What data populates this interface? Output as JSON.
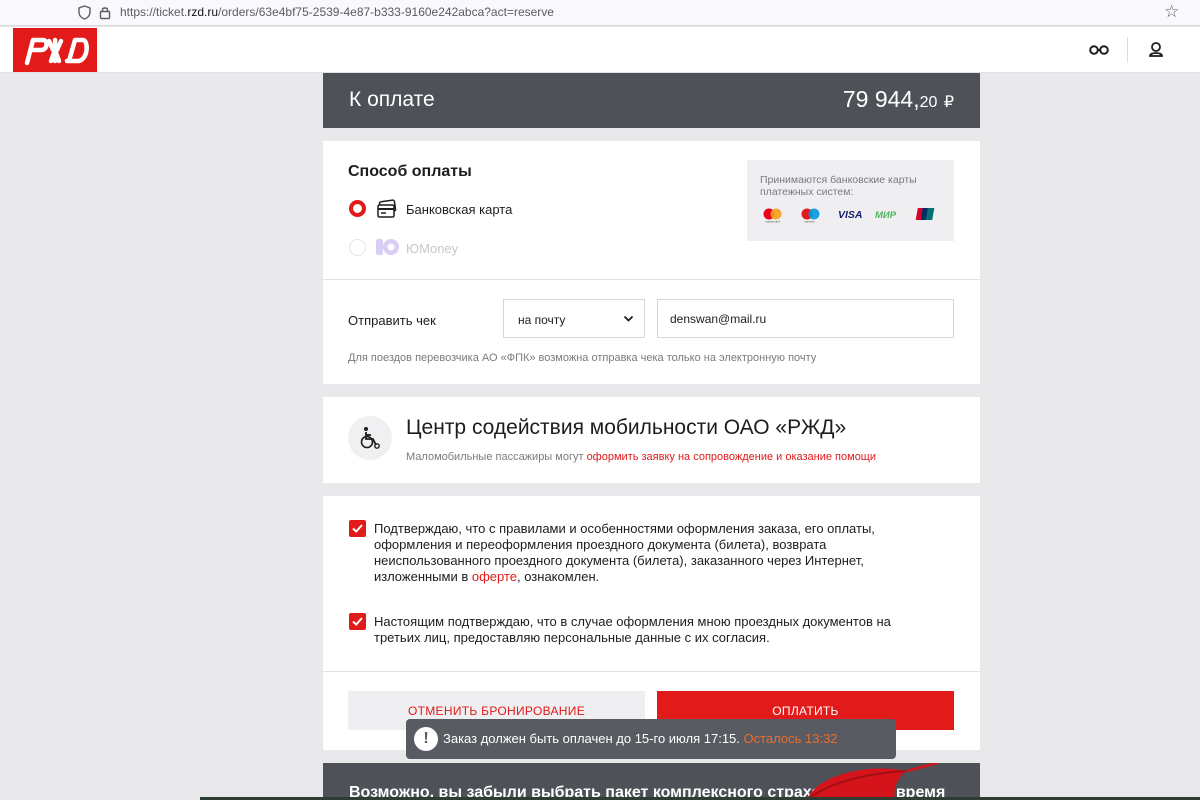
{
  "browser": {
    "url_prefix": "https://ticket.",
    "url_domain": "rzd.ru",
    "url_path": "/orders/63e4bf75-2539-4e87-b333-9160e242abca?act=reserve"
  },
  "header": {
    "logo_icon": "rzd-logo",
    "glasses_icon": "accessibility-glasses-icon",
    "user_icon": "user-icon"
  },
  "payment_header": {
    "title": "К оплате",
    "amount_main": "79 944,",
    "amount_kop": "20",
    "currency": "₽"
  },
  "payment_method": {
    "title": "Способ оплаты",
    "options": [
      {
        "label": "Банковская карта",
        "selected": true,
        "enabled": true
      },
      {
        "label": "ЮMoney",
        "selected": false,
        "enabled": false
      }
    ],
    "accepted_text": "Принимаются банковские карты платежных систем:",
    "card_systems": [
      "Mastercard",
      "Maestro",
      "VISA",
      "МИР",
      "UnionPay"
    ]
  },
  "receipt": {
    "label": "Отправить чек",
    "select_value": "на почту",
    "email_value": "denswan@mail.ru",
    "hint": "Для поездов перевозчика АО «ФПК» возможна отправка чека только на электронную почту"
  },
  "mobility": {
    "title": "Центр содействия мобильности ОАО «РЖД»",
    "text": "Маломобильные пассажиры могут ",
    "link": "оформить заявку на сопровождение и оказание помощи"
  },
  "agreements": {
    "first_text": "Подтверждаю, что с правилами и особенностями оформления заказа, его оплаты, оформления и переоформления проездного документа (билета), возврата неиспользованного проездного документа (билета), заказанного через Интернет, изложенными в ",
    "first_link": "оферте",
    "first_tail": ", ознакомлен.",
    "second_text": "Настоящим подтверждаю, что в случае оформления мною проездных документов на третьих лиц, предоставляю персональные данные с их согласия."
  },
  "actions": {
    "cancel_label": "ОТМЕНИТЬ БРОНИРОВАНИЕ",
    "pay_label": "ОПЛАТИТЬ"
  },
  "toast": {
    "message": "Заказ должен быть оплачен до 15-го июля 17:15. ",
    "remaining": "Осталось 13:32"
  },
  "promo": {
    "text": "Возможно, вы забыли выбрать пакет комплексного страхования на время"
  },
  "colors": {
    "brand_red": "#e21a1a",
    "dark_panel": "#4e5157",
    "toast_bg": "#585b61",
    "remaining_orange": "#ef6b2c"
  }
}
